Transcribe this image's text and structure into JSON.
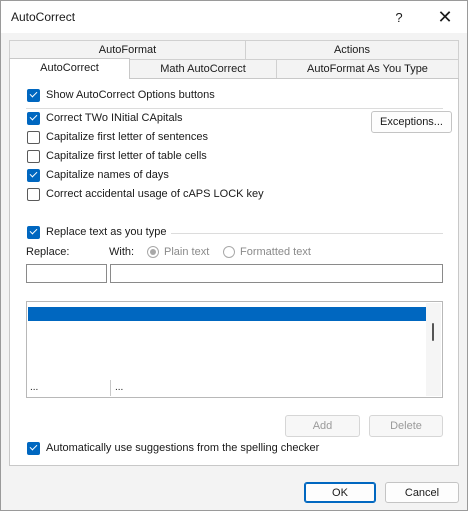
{
  "window": {
    "title": "AutoCorrect",
    "help_glyph": "?",
    "close_glyph": "✕"
  },
  "tabs": {
    "row1": [
      "AutoFormat",
      "Actions"
    ],
    "row2": [
      "AutoCorrect",
      "Math AutoCorrect",
      "AutoFormat As You Type"
    ],
    "active": "AutoCorrect"
  },
  "options": {
    "show_buttons": {
      "label": "Show AutoCorrect Options buttons",
      "checked": true
    },
    "two_initial": {
      "label": "Correct TWo INitial CApitals",
      "checked": true
    },
    "first_sentence": {
      "label": "Capitalize first letter of sentences",
      "checked": false
    },
    "first_table": {
      "label": "Capitalize first letter of table cells",
      "checked": false
    },
    "names_days": {
      "label": "Capitalize names of days",
      "checked": true
    },
    "caps_lock": {
      "label": "Correct accidental usage of cAPS LOCK key",
      "checked": false
    },
    "replace_text": {
      "label": "Replace text as you type",
      "checked": true
    },
    "spelling": {
      "label": "Automatically use suggestions from the spelling checker",
      "checked": true
    }
  },
  "exceptions_button": "Exceptions...",
  "replace": {
    "replace_label": "Replace:",
    "with_label": "With:",
    "plain_text": "Plain text",
    "formatted_text": "Formatted text",
    "replace_value": "",
    "with_value": ""
  },
  "list": {
    "col1_bottom": "...",
    "col2_bottom": "..."
  },
  "buttons": {
    "add": "Add",
    "delete": "Delete",
    "ok": "OK",
    "cancel": "Cancel"
  },
  "colors": {
    "accent": "#0067c0",
    "background": "#f3f3f3"
  }
}
